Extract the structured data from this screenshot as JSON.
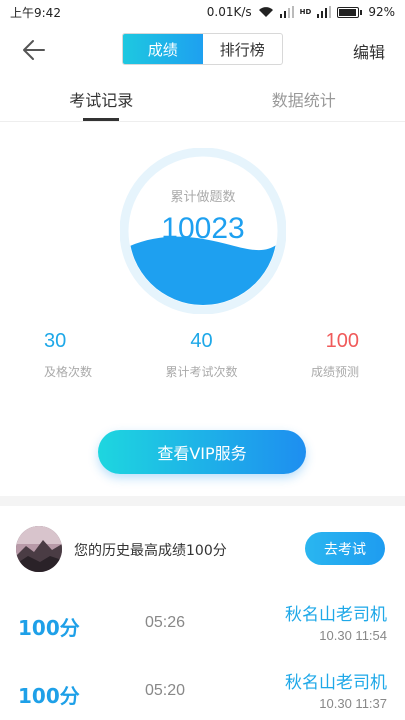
{
  "status_bar": {
    "time": "上午9:42",
    "speed": "0.01K/s",
    "network": "HD",
    "battery_text": "92%",
    "battery_level": 0.92
  },
  "header": {
    "segments": [
      {
        "label": "成绩",
        "active": true
      },
      {
        "label": "排行榜",
        "active": false
      }
    ],
    "edit_label": "编辑",
    "back_icon": "arrow-left-icon"
  },
  "tabs": [
    {
      "label": "考试记录",
      "active": true
    },
    {
      "label": "数据统计",
      "active": false
    }
  ],
  "gauge": {
    "label": "累计做题数",
    "value": "10023",
    "fill_level": 0.42,
    "color": "#1ea0f0"
  },
  "stats": [
    {
      "value": "30",
      "label": "及格次数",
      "color": "#1ea8e8"
    },
    {
      "value": "40",
      "label": "累计考试次数",
      "color": "#1ea8e8"
    },
    {
      "value": "100",
      "label": "成绩预测",
      "color": "#f05a5a"
    }
  ],
  "vip_button": "查看VIP服务",
  "best": {
    "text": "您的历史最高成绩100分",
    "button": "去考试"
  },
  "records": [
    {
      "score": "100分",
      "duration": "05:26",
      "name": "秋名山老司机",
      "date": "10.30  11:54"
    },
    {
      "score": "100分",
      "duration": "05:20",
      "name": "秋名山老司机",
      "date": "10.30  11:37"
    }
  ]
}
